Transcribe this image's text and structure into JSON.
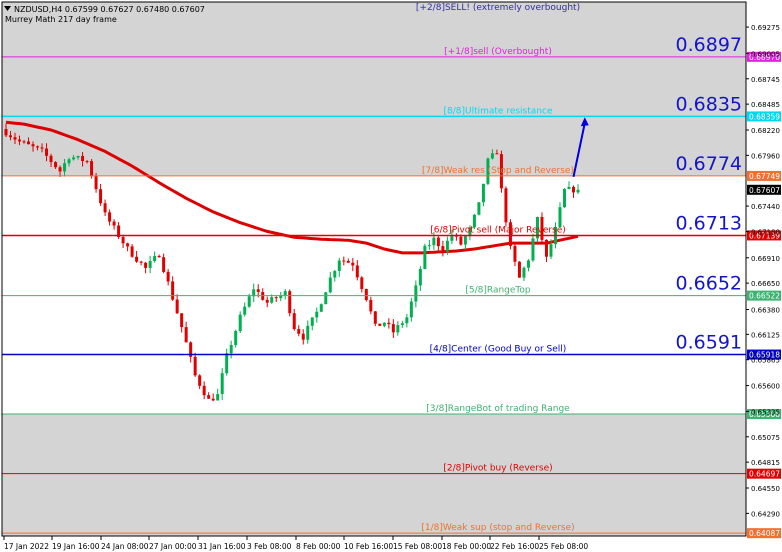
{
  "header": {
    "symbol_line": "NZDUSD,H4  0.67599 0.67627 0.67480 0.67607",
    "subtitle": "Murrey Math 217 day frame"
  },
  "colors": {
    "plot_bg": "#d4d4d4",
    "zone_bg": "#ffffff",
    "bull_candle": "#00b050",
    "bear_candle": "#e00000",
    "ma_line": "#dd0000",
    "arrow": "#0000dd",
    "price_label": "#1515c8"
  },
  "chart_data": {
    "type": "candlestick",
    "timeframe": "H4",
    "ylim": [
      0.64058,
      0.69532
    ],
    "price_axis_ticks": [
      0.69275,
      0.69005,
      0.68745,
      0.68485,
      0.6822,
      0.6796,
      0.6744,
      0.6718,
      0.6691,
      0.6665,
      0.6638,
      0.66125,
      0.65865,
      0.656,
      0.65335,
      0.65075,
      0.64815,
      0.6455,
      0.6429,
      0.6403
    ],
    "time_labels": [
      "17 Jan 2022",
      "19 Jan 16:00",
      "24 Jan 08:00",
      "27 Jan 00:00",
      "31 Jan 16:00",
      "3 Feb 08:00",
      "8 Feb 00:00",
      "10 Feb 16:00",
      "15 Feb 08:00",
      "18 Feb 00:00",
      "22 Feb 16:00",
      "25 Feb 08:00"
    ],
    "current_price": 0.67607,
    "current_price_label": "0.67607",
    "close_path": [
      [
        0,
        0.682
      ],
      [
        3,
        0.681
      ],
      [
        8,
        0.68
      ],
      [
        12,
        0.678
      ],
      [
        14,
        0.6795
      ],
      [
        18,
        0.679
      ],
      [
        22,
        0.6735
      ],
      [
        27,
        0.67
      ],
      [
        31,
        0.668
      ],
      [
        34,
        0.6695
      ],
      [
        37,
        0.665
      ],
      [
        39,
        0.662
      ],
      [
        42,
        0.657
      ],
      [
        45,
        0.6545
      ],
      [
        47,
        0.655
      ],
      [
        49,
        0.659
      ],
      [
        52,
        0.663
      ],
      [
        55,
        0.666
      ],
      [
        58,
        0.6645
      ],
      [
        62,
        0.6655
      ],
      [
        64,
        0.662
      ],
      [
        66,
        0.661
      ],
      [
        69,
        0.6635
      ],
      [
        72,
        0.667
      ],
      [
        74,
        0.669
      ],
      [
        77,
        0.6685
      ],
      [
        80,
        0.665
      ],
      [
        82,
        0.662
      ],
      [
        84,
        0.6625
      ],
      [
        86,
        0.6615
      ],
      [
        89,
        0.663
      ],
      [
        91,
        0.666
      ],
      [
        93,
        0.67
      ],
      [
        95,
        0.671
      ],
      [
        97,
        0.67
      ],
      [
        99,
        0.6715
      ],
      [
        101,
        0.6705
      ],
      [
        103,
        0.672
      ],
      [
        105,
        0.6745
      ],
      [
        107,
        0.679
      ],
      [
        109,
        0.68
      ],
      [
        110,
        0.676
      ],
      [
        112,
        0.67
      ],
      [
        114,
        0.667
      ],
      [
        116,
        0.669
      ],
      [
        118,
        0.673
      ],
      [
        120,
        0.669
      ],
      [
        122,
        0.672
      ],
      [
        124,
        0.676
      ],
      [
        126,
        0.6761
      ]
    ],
    "moving_average": [
      [
        0,
        0.683
      ],
      [
        4,
        0.6828
      ],
      [
        10,
        0.6822
      ],
      [
        16,
        0.6812
      ],
      [
        22,
        0.68
      ],
      [
        28,
        0.6785
      ],
      [
        34,
        0.6768
      ],
      [
        40,
        0.6752
      ],
      [
        46,
        0.6738
      ],
      [
        52,
        0.6727
      ],
      [
        58,
        0.6718
      ],
      [
        64,
        0.6712
      ],
      [
        70,
        0.671
      ],
      [
        76,
        0.6709
      ],
      [
        80,
        0.6706
      ],
      [
        84,
        0.67
      ],
      [
        88,
        0.6696
      ],
      [
        92,
        0.6696
      ],
      [
        96,
        0.6697
      ],
      [
        100,
        0.6698
      ],
      [
        104,
        0.67
      ],
      [
        108,
        0.6703
      ],
      [
        112,
        0.6706
      ],
      [
        116,
        0.6706
      ],
      [
        120,
        0.6706
      ],
      [
        124,
        0.671
      ],
      [
        127,
        0.6713
      ]
    ],
    "bar_count": 128,
    "forecast_arrow": {
      "from": [
        126,
        0.6774
      ],
      "to": [
        128.5,
        0.6835
      ]
    },
    "murrey_levels": [
      {
        "name": "+2/8",
        "price": 0.6958,
        "price_label": "",
        "label": "[+2/8]SELL! (extremely overbought)",
        "color": "#3030a0",
        "big_label": ""
      },
      {
        "name": "+1/8",
        "price": 0.6897,
        "price_label": "0.68970",
        "label": "[+1/8]sell (Overbought)",
        "color": "#e020e0",
        "big_label": "0.6897"
      },
      {
        "name": "8/8",
        "price": 0.68359,
        "price_label": "0.68359",
        "label": "[8/8]Ultimate resistance",
        "color": "#00d8f0",
        "big_label": "0.6835"
      },
      {
        "name": "7/8",
        "price": 0.67749,
        "price_label": "0.67749",
        "label": "[7/8]Weak res (Stop and Reverse)",
        "color": "#f07030",
        "big_label": "0.6774"
      },
      {
        "name": "6/8",
        "price": 0.67139,
        "price_label": "0.67139",
        "label": "[6/8]Pivot sell (Major Reverse)",
        "color": "#e00000",
        "big_label": "0.6713"
      },
      {
        "name": "5/8",
        "price": 0.66522,
        "price_label": "0.66522",
        "label": "[5/8]RangeTop",
        "color": "#3cb371",
        "big_label": "0.6652"
      },
      {
        "name": "4/8",
        "price": 0.65918,
        "price_label": "0.65918",
        "label": "[4/8]Center (Good Buy or Sell)",
        "color": "#0000c8",
        "big_label": "0.6591"
      },
      {
        "name": "3/8",
        "price": 0.65308,
        "price_label": "0.65308",
        "label": "[3/8]RangeBot of trading Range",
        "color": "#3cb371",
        "big_label": ""
      },
      {
        "name": "2/8",
        "price": 0.64697,
        "price_label": "0.64697",
        "label": "[2/8]Pivot buy (Reverse)",
        "color": "#e00000",
        "big_label": ""
      },
      {
        "name": "1/8",
        "price": 0.64087,
        "price_label": "0.64087",
        "label": "[1/8]Weak sup (stop and Reverse)",
        "color": "#f07030",
        "big_label": ""
      }
    ]
  }
}
